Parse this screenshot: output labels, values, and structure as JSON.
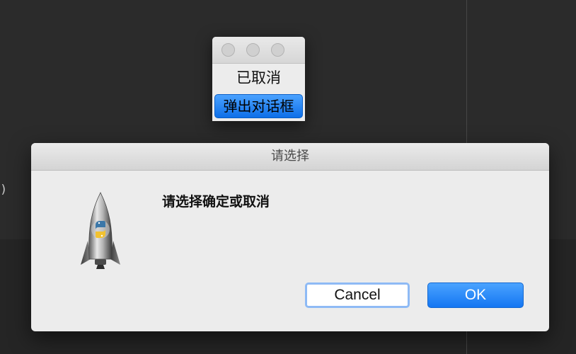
{
  "background": {
    "partial_text": ")",
    "colors": {
      "desktop": "#2b2b2b",
      "band": "#252525"
    }
  },
  "root_window": {
    "label": "已取消",
    "button_label": "弹出对话框",
    "button_color": "#1a7cf0"
  },
  "dialog": {
    "title": "请选择",
    "message": "请选择确定或取消",
    "icon": "python-launcher-rocket-icon",
    "cancel_label": "Cancel",
    "ok_label": "OK",
    "accent_color": "#1a7cf0",
    "focus_ring_color": "#8ebaf5"
  }
}
